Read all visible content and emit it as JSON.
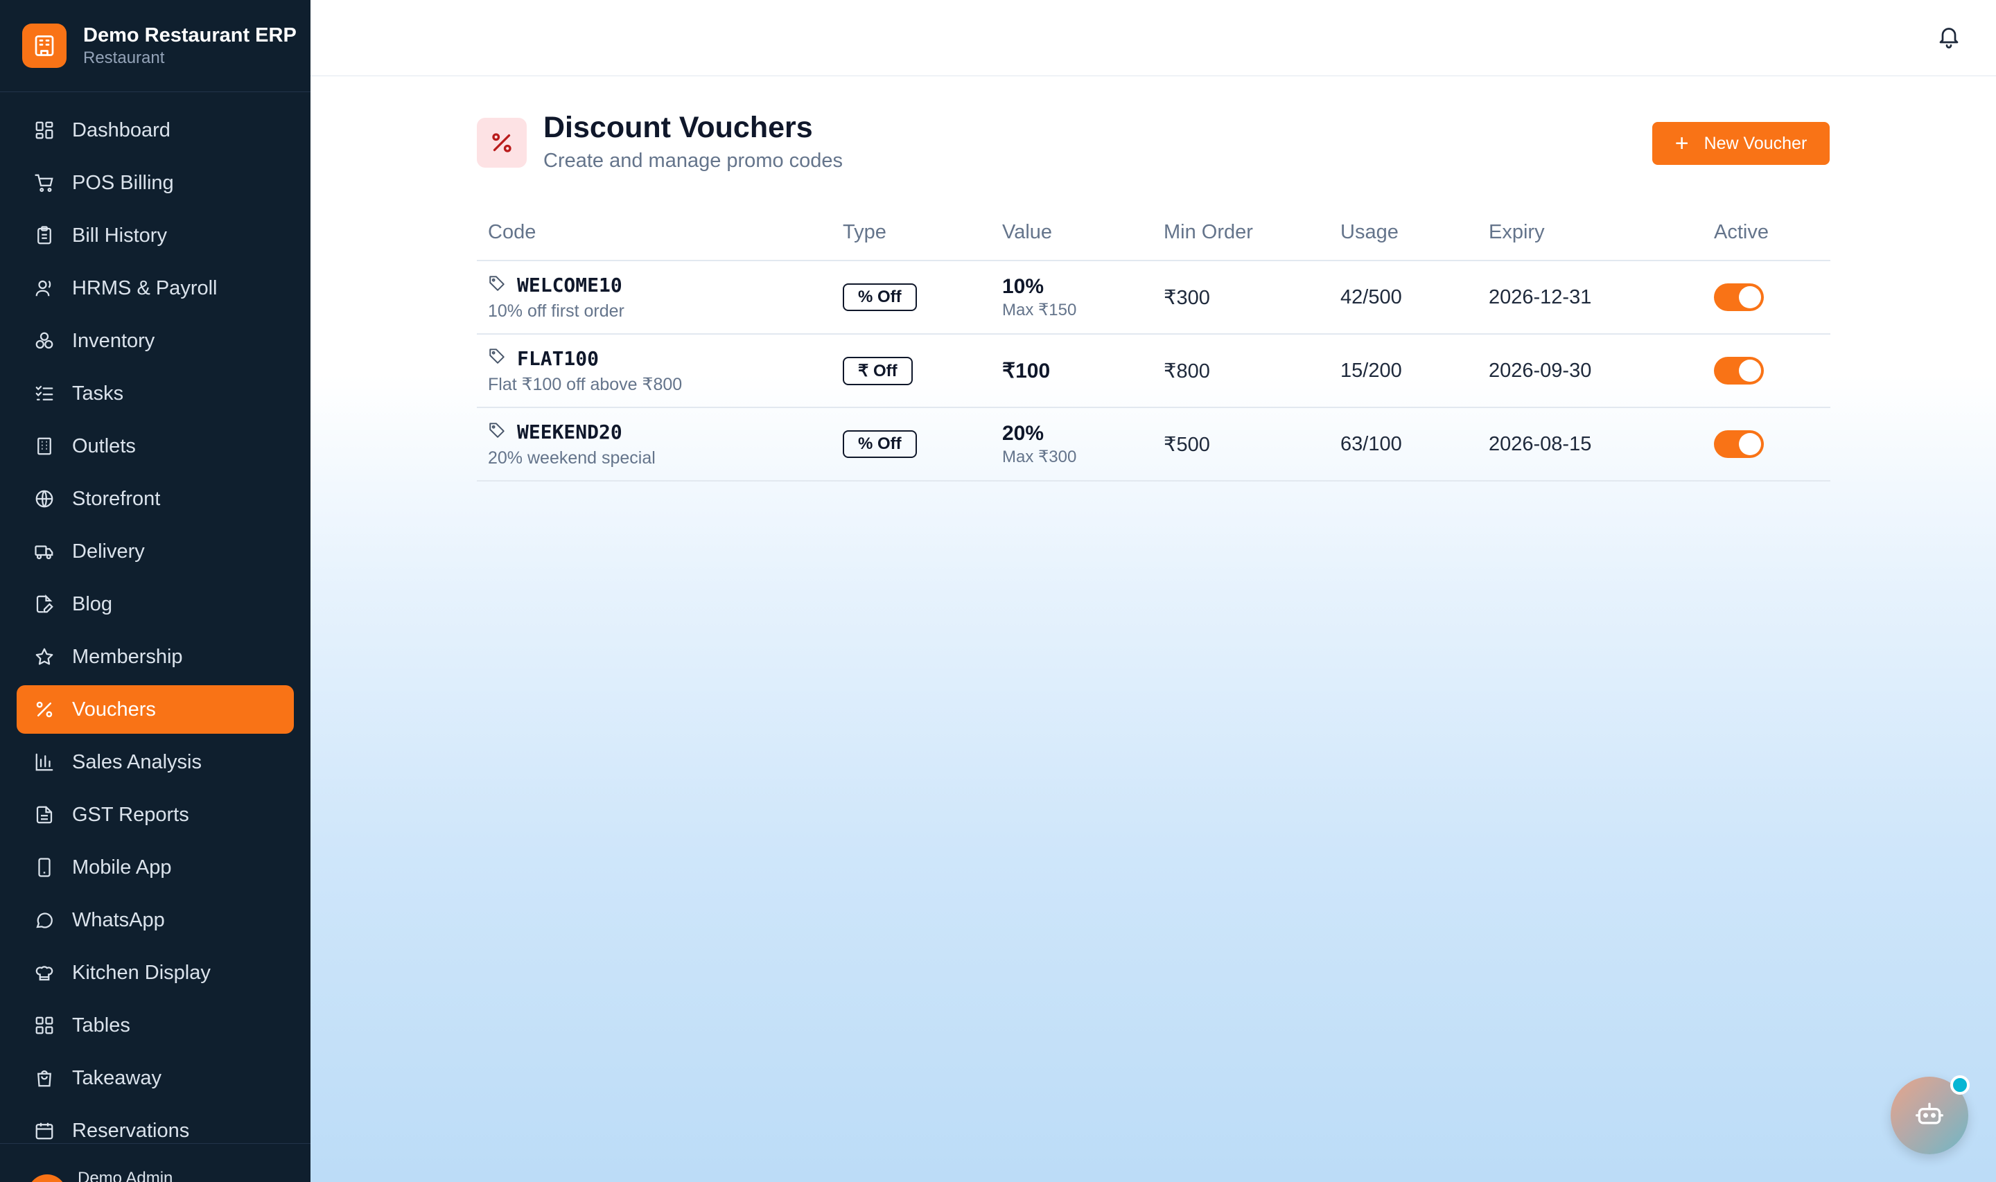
{
  "brand": {
    "title": "Demo Restaurant ERP",
    "subtitle": "Restaurant"
  },
  "sidebar": {
    "items": [
      {
        "label": "Dashboard",
        "icon": "dashboard-icon"
      },
      {
        "label": "POS Billing",
        "icon": "cart-icon"
      },
      {
        "label": "Bill History",
        "icon": "clipboard-icon"
      },
      {
        "label": "HRMS & Payroll",
        "icon": "user-icon"
      },
      {
        "label": "Inventory",
        "icon": "boxes-icon"
      },
      {
        "label": "Tasks",
        "icon": "checklist-icon"
      },
      {
        "label": "Outlets",
        "icon": "building-icon"
      },
      {
        "label": "Storefront",
        "icon": "globe-icon"
      },
      {
        "label": "Delivery",
        "icon": "truck-icon"
      },
      {
        "label": "Blog",
        "icon": "file-pen-icon"
      },
      {
        "label": "Membership",
        "icon": "star-icon"
      },
      {
        "label": "Vouchers",
        "icon": "percent-icon",
        "active": true
      },
      {
        "label": "Sales Analysis",
        "icon": "bar-chart-icon"
      },
      {
        "label": "GST Reports",
        "icon": "file-text-icon"
      },
      {
        "label": "Mobile App",
        "icon": "smartphone-icon"
      },
      {
        "label": "WhatsApp",
        "icon": "chat-bubble-icon"
      },
      {
        "label": "Kitchen Display",
        "icon": "chef-hat-icon"
      },
      {
        "label": "Tables",
        "icon": "grid-icon"
      },
      {
        "label": "Takeaway",
        "icon": "shopping-bag-icon"
      },
      {
        "label": "Reservations",
        "icon": "calendar-icon"
      }
    ],
    "user_name": "Demo Admin"
  },
  "page": {
    "title": "Discount Vouchers",
    "subtitle": "Create and manage promo codes",
    "new_button": "New Voucher"
  },
  "table": {
    "headers": [
      "Code",
      "Type",
      "Value",
      "Min Order",
      "Usage",
      "Expiry",
      "Active"
    ],
    "rows": [
      {
        "code": "WELCOME10",
        "desc": "10% off first order",
        "type": "% Off",
        "value": "10%",
        "value_sub": "Max ₹150",
        "min_order": "₹300",
        "usage": "42/500",
        "expiry": "2026-12-31",
        "active": true
      },
      {
        "code": "FLAT100",
        "desc": "Flat ₹100 off above ₹800",
        "type": "₹ Off",
        "value": "₹100",
        "value_sub": "",
        "min_order": "₹800",
        "usage": "15/200",
        "expiry": "2026-09-30",
        "active": true
      },
      {
        "code": "WEEKEND20",
        "desc": "20% weekend special",
        "type": "% Off",
        "value": "20%",
        "value_sub": "Max ₹300",
        "min_order": "₹500",
        "usage": "63/100",
        "expiry": "2026-08-15",
        "active": true
      }
    ]
  },
  "colors": {
    "accent": "#f97316",
    "sidebar_bg": "#0f1f2e",
    "badge_bg": "#fde2e4"
  }
}
